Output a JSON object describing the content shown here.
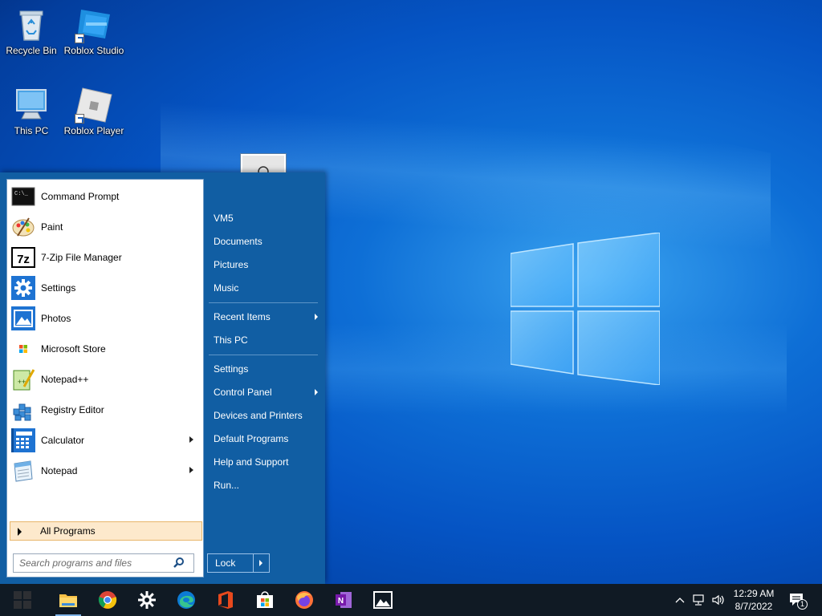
{
  "desktop": {
    "icons": [
      {
        "label": "Recycle Bin",
        "icon": "recycle-bin-icon"
      },
      {
        "label": "Roblox Studio",
        "icon": "roblox-studio-icon"
      },
      {
        "label": "This PC",
        "icon": "this-pc-icon"
      },
      {
        "label": "Roblox Player",
        "icon": "roblox-player-icon"
      }
    ]
  },
  "start_menu": {
    "programs": [
      {
        "label": "Command Prompt",
        "icon": "command-prompt-icon",
        "has_submenu": false
      },
      {
        "label": "Paint",
        "icon": "paint-icon",
        "has_submenu": false
      },
      {
        "label": "7-Zip File Manager",
        "icon": "7zip-icon",
        "has_submenu": false
      },
      {
        "label": "Settings",
        "icon": "settings-gear-icon",
        "has_submenu": false
      },
      {
        "label": "Photos",
        "icon": "photos-icon",
        "has_submenu": false
      },
      {
        "label": "Microsoft Store",
        "icon": "microsoft-store-icon",
        "has_submenu": false
      },
      {
        "label": "Notepad++",
        "icon": "notepad-plus-plus-icon",
        "has_submenu": false
      },
      {
        "label": "Registry Editor",
        "icon": "registry-editor-icon",
        "has_submenu": false
      },
      {
        "label": "Calculator",
        "icon": "calculator-icon",
        "has_submenu": true
      },
      {
        "label": "Notepad",
        "icon": "notepad-icon",
        "has_submenu": true
      }
    ],
    "all_programs_label": "All Programs",
    "search_placeholder": "Search programs and files",
    "right_items": [
      {
        "label": "VM5",
        "has_submenu": false
      },
      {
        "label": "Documents",
        "has_submenu": false
      },
      {
        "label": "Pictures",
        "has_submenu": false
      },
      {
        "label": "Music",
        "has_submenu": false
      },
      {
        "label": "Recent Items",
        "has_submenu": true
      },
      {
        "label": "This PC",
        "has_submenu": false
      },
      {
        "label": "Settings",
        "has_submenu": false
      },
      {
        "label": "Control Panel",
        "has_submenu": true
      },
      {
        "label": "Devices and Printers",
        "has_submenu": false
      },
      {
        "label": "Default Programs",
        "has_submenu": false
      },
      {
        "label": "Help and Support",
        "has_submenu": false
      },
      {
        "label": "Run...",
        "has_submenu": false
      }
    ],
    "lock_label": "Lock"
  },
  "taskbar": {
    "apps": [
      "file-explorer-icon",
      "chrome-icon",
      "settings-icon",
      "edge-icon",
      "office-icon",
      "store-icon",
      "firefox-icon",
      "onenote-icon",
      "photos-icon"
    ],
    "clock": {
      "time": "12:29 AM",
      "date": "8/7/2022"
    },
    "notification_count": "1"
  },
  "colors": {
    "start_menu_bg": "#115ea3",
    "taskbar_bg": "#101a24",
    "all_programs_highlight": "#fde9cc"
  }
}
